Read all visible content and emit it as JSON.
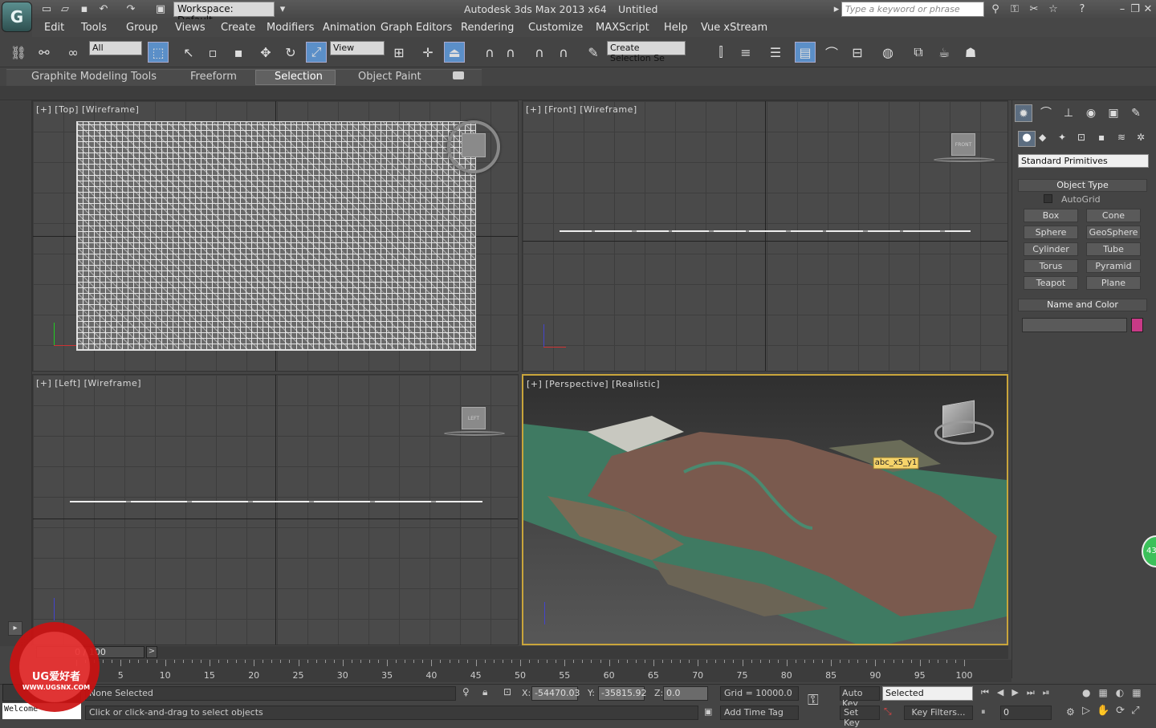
{
  "titlebar": {
    "logo": "G",
    "workspace": "Workspace: Default",
    "app_title": "Autodesk 3ds Max  2013 x64",
    "doc_title": "Untitled",
    "search_placeholder": "Type a keyword or phrase"
  },
  "menu": [
    "Edit",
    "Tools",
    "Group",
    "Views",
    "Create",
    "Modifiers",
    "Animation",
    "Graph Editors",
    "Rendering",
    "Customize",
    "MAXScript",
    "Help",
    "Vue xStream"
  ],
  "toolbar": {
    "filter": "All",
    "ref_coord": "View",
    "named_selection": "Create Selection Se"
  },
  "ribbon": {
    "tabs": [
      "Graphite Modeling Tools",
      "Freeform",
      "Selection",
      "Object Paint"
    ]
  },
  "viewports": {
    "top": "[+] [Top] [Wireframe]",
    "front": "[+] [Front] [Wireframe]",
    "left": "[+] [Left] [Wireframe]",
    "perspective": "[+] [Perspective] [Realistic]",
    "front_cube": "FRONT",
    "left_cube": "LEFT",
    "object_tag": "abc_x5_y1"
  },
  "command_panel": {
    "dropdown": "Standard Primitives",
    "object_type_title": "Object Type",
    "autogrid": "AutoGrid",
    "buttons": [
      "Box",
      "Cone",
      "Sphere",
      "GeoSphere",
      "Cylinder",
      "Tube",
      "Torus",
      "Pyramid",
      "Teapot",
      "Plane"
    ],
    "name_color_title": "Name and Color",
    "object_color": "#c83a86"
  },
  "timeline": {
    "frame": "0 / 100",
    "ticks": [
      "5",
      "10",
      "15",
      "20",
      "25",
      "30",
      "35",
      "40",
      "45",
      "50",
      "55",
      "60",
      "65",
      "70",
      "75",
      "80",
      "85",
      "90",
      "95",
      "100"
    ]
  },
  "status": {
    "selection": "None Selected",
    "prompt": "Click or click-and-drag to select objects",
    "x": "-54470.03",
    "y": "-35815.92",
    "z": "0.0",
    "grid": "Grid = 10000.0",
    "auto_key": "Auto Key",
    "key_mode": "Selected",
    "set_key": "Set Key",
    "key_filters": "Key Filters...",
    "add_time_tag": "Add Time Tag",
    "current_frame": "0",
    "welcome": "Welcome",
    "side_badge": "43"
  },
  "watermark": {
    "brand": "UG爱好者",
    "url": "WWW.UGSNX.COM"
  }
}
